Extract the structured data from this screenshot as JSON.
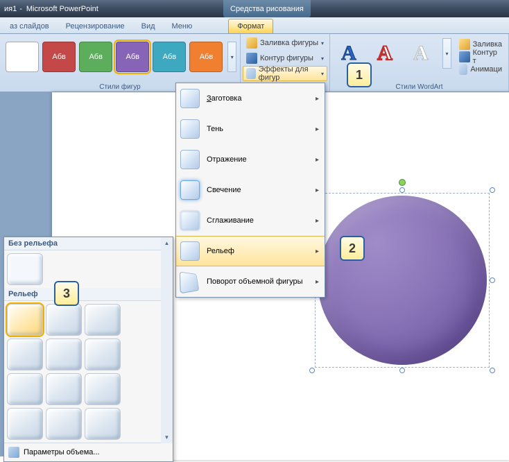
{
  "title": {
    "doc": "ия1",
    "app": "Microsoft PowerPoint",
    "context_tab": "Средства рисования"
  },
  "tabs": {
    "slideshow": "аз слайдов",
    "review": "Рецензирование",
    "view": "Вид",
    "menu": "Меню",
    "format": "Формат"
  },
  "ribbon": {
    "shape_styles_label": "Стили фигур",
    "wordart_label": "Стили WordArt",
    "swatch_text": "Абв",
    "swatch_colors": [
      "#c44848",
      "#5cae5c",
      "#8864b8",
      "#3ea8c0",
      "#f08030"
    ],
    "fill": "Заливка фигуры",
    "outline": "Контур фигуры",
    "effects": "Эффекты для фигур",
    "wa_fill": "Заливка",
    "wa_outline": "Контур т",
    "wa_anim": "Анимаци"
  },
  "fx_menu": {
    "preset": "Заготовка",
    "shadow": "Тень",
    "reflection": "Отражение",
    "glow": "Свечение",
    "soft": "Сглаживание",
    "bevel": "Рельеф",
    "rotation": "Поворот объемной фигуры"
  },
  "bevel": {
    "no_bevel": "Без рельефа",
    "bevel_hdr": "Рельеф",
    "options": "Параметры объема..."
  },
  "callouts": {
    "c1": "1",
    "c2": "2",
    "c3": "3"
  }
}
